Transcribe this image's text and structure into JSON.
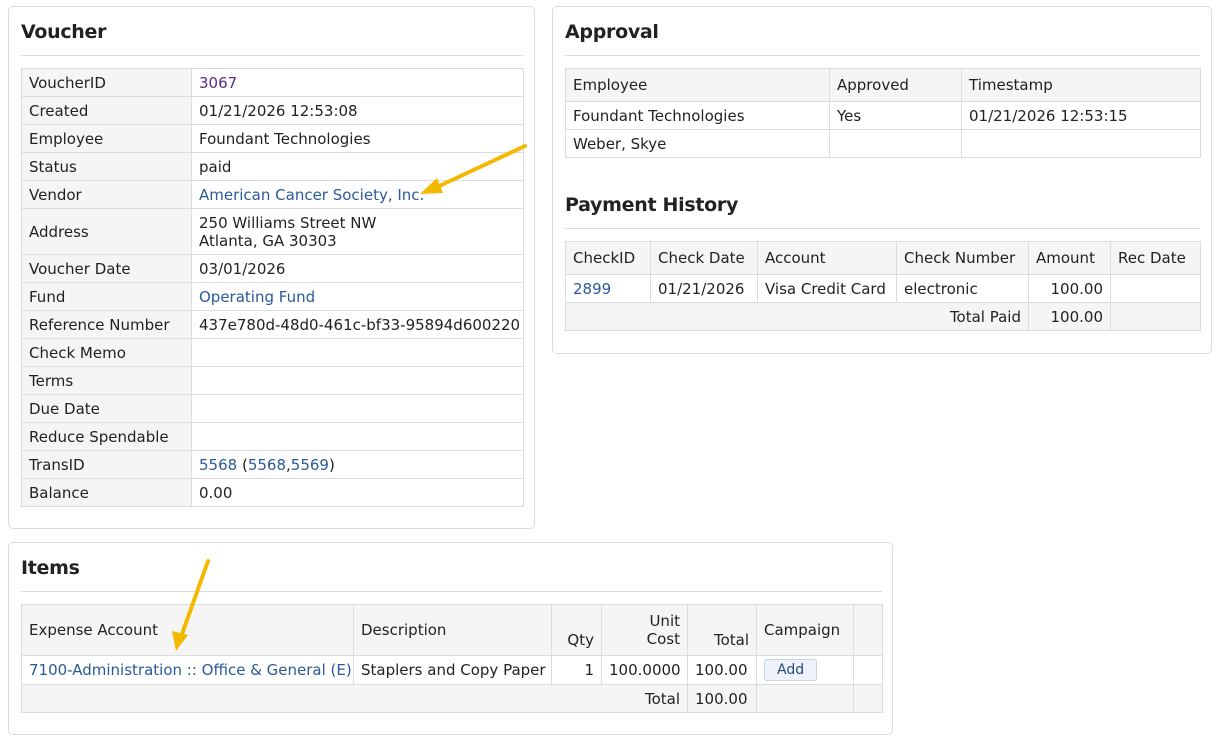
{
  "voucher": {
    "title": "Voucher",
    "rows": [
      {
        "label": "VoucherID",
        "value": "3067"
      },
      {
        "label": "Created",
        "value": "01/21/2026 12:53:08"
      },
      {
        "label": "Employee",
        "value": "Foundant Technologies"
      },
      {
        "label": "Status",
        "value": "paid"
      },
      {
        "label": "Vendor",
        "value": "American Cancer Society, Inc."
      },
      {
        "label": "Address",
        "line1": "250 Williams Street NW",
        "line2": "Atlanta, GA 30303"
      },
      {
        "label": "Voucher Date",
        "value": "03/01/2026"
      },
      {
        "label": "Fund",
        "value": "Operating Fund"
      },
      {
        "label": "Reference Number",
        "value": "437e780d-48d0-461c-bf33-95894d600220"
      },
      {
        "label": "Check Memo",
        "value": ""
      },
      {
        "label": "Terms",
        "value": ""
      },
      {
        "label": "Due Date",
        "value": ""
      },
      {
        "label": "Reduce Spendable",
        "value": ""
      },
      {
        "label": "TransID",
        "value": "5568",
        "sub1": "5568",
        "sub2": "5569"
      },
      {
        "label": "Balance",
        "value": "0.00"
      }
    ]
  },
  "approval": {
    "title": "Approval",
    "headers": [
      "Employee",
      "Approved",
      "Timestamp"
    ],
    "rows": [
      [
        "Foundant Technologies",
        "Yes",
        "01/21/2026 12:53:15"
      ],
      [
        "Weber, Skye",
        "",
        ""
      ]
    ]
  },
  "payment": {
    "title": "Payment History",
    "headers": [
      "CheckID",
      "Check Date",
      "Account",
      "Check Number",
      "Amount",
      "Rec Date"
    ],
    "row": {
      "check_id": "2899",
      "check_date": "01/21/2026",
      "account": "Visa Credit Card",
      "check_number": "electronic",
      "amount": "100.00",
      "rec_date": ""
    },
    "total_label": "Total Paid",
    "total_value": "100.00"
  },
  "items": {
    "title": "Items",
    "headers": {
      "expense_account": "Expense Account",
      "description": "Description",
      "qty": "Qty",
      "unit_cost_1": "Unit",
      "unit_cost_2": "Cost",
      "total": "Total",
      "campaign": "Campaign"
    },
    "row": {
      "expense_account": "7100-Administration :: Office & General (E)",
      "description": "Staplers and Copy Paper",
      "qty": "1",
      "unit_cost": "100.0000",
      "total": "100.00",
      "campaign_button": "Add"
    },
    "total_label": "Total",
    "total_value": "100.00"
  },
  "colors": {
    "link": "#2a5a9a",
    "visited_link": "#5b2a86",
    "arrow": "#f5b800",
    "label_bg": "#f5f5f5"
  }
}
